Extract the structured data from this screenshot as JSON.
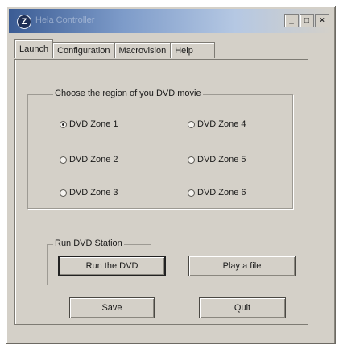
{
  "window": {
    "title": "Hela Controller",
    "icon_glyph": "Z",
    "controls": [
      "_",
      "□",
      "×"
    ]
  },
  "tabs": [
    {
      "label": "Launch",
      "active": true
    },
    {
      "label": "Configuration",
      "active": false
    },
    {
      "label": "Macrovision",
      "active": false
    },
    {
      "label": "Help",
      "active": false
    }
  ],
  "region_group": {
    "label": "Choose the region of you DVD movie",
    "options": [
      {
        "label": "DVD Zone 1",
        "selected": true
      },
      {
        "label": "DVD Zone 4",
        "selected": false
      },
      {
        "label": "DVD Zone 2",
        "selected": false
      },
      {
        "label": "DVD Zone 5",
        "selected": false
      },
      {
        "label": "DVD Zone 3",
        "selected": false
      },
      {
        "label": "DVD Zone 6",
        "selected": false
      }
    ]
  },
  "run_group": {
    "label": "Run DVD Station",
    "run_button": "Run the DVD",
    "play_button": "Play a file"
  },
  "footer": {
    "save_button": "Save",
    "quit_button": "Quit"
  },
  "colors": {
    "face": "#d4d0c8",
    "title_start": "#3b5c94"
  }
}
